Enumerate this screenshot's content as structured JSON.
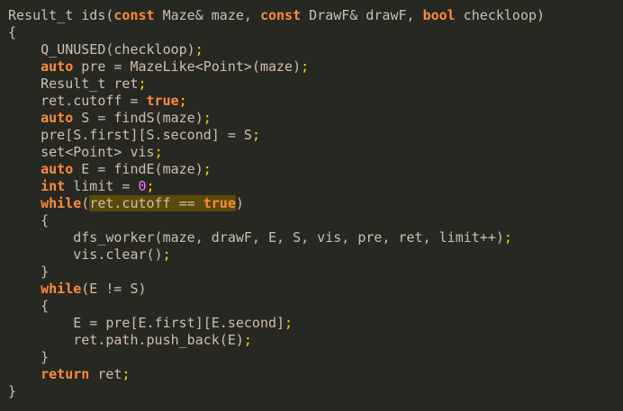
{
  "editor": {
    "background": "#272822",
    "colors": {
      "text": "#cfbfad",
      "keyword": "#ff8b39",
      "number": "#ff73fd",
      "semicolon": "#ffd700",
      "highlight": "#5a4a0a"
    },
    "lines": [
      {
        "segments": [
          {
            "t": "Result_t ids(",
            "c": "plain"
          },
          {
            "t": "const",
            "c": "kw"
          },
          {
            "t": " Maze& maze, ",
            "c": "plain"
          },
          {
            "t": "const",
            "c": "kw"
          },
          {
            "t": " DrawF& drawF, ",
            "c": "plain"
          },
          {
            "t": "bool",
            "c": "kw"
          },
          {
            "t": " checkloop)",
            "c": "plain"
          }
        ]
      },
      {
        "segments": [
          {
            "t": "{",
            "c": "plain"
          }
        ]
      },
      {
        "segments": [
          {
            "t": "    Q_UNUSED(checkloop)",
            "c": "plain"
          },
          {
            "t": ";",
            "c": "semi"
          }
        ]
      },
      {
        "segments": [
          {
            "t": "    ",
            "c": "plain"
          },
          {
            "t": "auto",
            "c": "kw"
          },
          {
            "t": " pre = MazeLike<Point>(maze)",
            "c": "plain"
          },
          {
            "t": ";",
            "c": "semi"
          }
        ]
      },
      {
        "segments": [
          {
            "t": "    Result_t ret",
            "c": "plain"
          },
          {
            "t": ";",
            "c": "semi"
          }
        ]
      },
      {
        "segments": [
          {
            "t": "    ret.cutoff = ",
            "c": "plain"
          },
          {
            "t": "true",
            "c": "kw"
          },
          {
            "t": ";",
            "c": "semi"
          }
        ]
      },
      {
        "segments": [
          {
            "t": "    ",
            "c": "plain"
          },
          {
            "t": "auto",
            "c": "kw"
          },
          {
            "t": " S = findS(maze)",
            "c": "plain"
          },
          {
            "t": ";",
            "c": "semi"
          }
        ]
      },
      {
        "segments": [
          {
            "t": "    pre[S.first][S.second] = S",
            "c": "plain"
          },
          {
            "t": ";",
            "c": "semi"
          }
        ]
      },
      {
        "segments": [
          {
            "t": "    set<Point> vis",
            "c": "plain"
          },
          {
            "t": ";",
            "c": "semi"
          }
        ]
      },
      {
        "segments": [
          {
            "t": "    ",
            "c": "plain"
          },
          {
            "t": "auto",
            "c": "kw"
          },
          {
            "t": " E = findE(maze)",
            "c": "plain"
          },
          {
            "t": ";",
            "c": "semi"
          }
        ]
      },
      {
        "segments": [
          {
            "t": "    ",
            "c": "plain"
          },
          {
            "t": "int",
            "c": "kw"
          },
          {
            "t": " limit = ",
            "c": "plain"
          },
          {
            "t": "0",
            "c": "num"
          },
          {
            "t": ";",
            "c": "semi"
          }
        ]
      },
      {
        "segments": [
          {
            "t": "    ",
            "c": "plain"
          },
          {
            "t": "while",
            "c": "kw"
          },
          {
            "t": "(",
            "c": "plain"
          },
          {
            "t": "ret.cutoff == ",
            "c": "plain hl"
          },
          {
            "t": "true",
            "c": "kw hl"
          },
          {
            "t": ")",
            "c": "plain"
          }
        ]
      },
      {
        "segments": [
          {
            "t": "    {",
            "c": "plain"
          }
        ]
      },
      {
        "segments": [
          {
            "t": "        dfs_worker(maze, drawF, E, S, vis, pre, ret, limit++)",
            "c": "plain"
          },
          {
            "t": ";",
            "c": "semi"
          }
        ]
      },
      {
        "segments": [
          {
            "t": "        vis.clear()",
            "c": "plain"
          },
          {
            "t": ";",
            "c": "semi"
          }
        ]
      },
      {
        "segments": [
          {
            "t": "    }",
            "c": "plain"
          }
        ]
      },
      {
        "segments": [
          {
            "t": "    ",
            "c": "plain"
          },
          {
            "t": "while",
            "c": "kw"
          },
          {
            "t": "(E != S)",
            "c": "plain"
          }
        ]
      },
      {
        "segments": [
          {
            "t": "    {",
            "c": "plain"
          }
        ]
      },
      {
        "segments": [
          {
            "t": "        E = pre[E.first][E.second]",
            "c": "plain"
          },
          {
            "t": ";",
            "c": "semi"
          }
        ]
      },
      {
        "segments": [
          {
            "t": "        ret.path.push_back(E)",
            "c": "plain"
          },
          {
            "t": ";",
            "c": "semi"
          }
        ]
      },
      {
        "segments": [
          {
            "t": "    }",
            "c": "plain"
          }
        ]
      },
      {
        "segments": [
          {
            "t": "    ",
            "c": "plain"
          },
          {
            "t": "return",
            "c": "kw"
          },
          {
            "t": " ret",
            "c": "plain"
          },
          {
            "t": ";",
            "c": "semi"
          }
        ]
      },
      {
        "segments": [
          {
            "t": "}",
            "c": "plain"
          }
        ]
      }
    ]
  }
}
